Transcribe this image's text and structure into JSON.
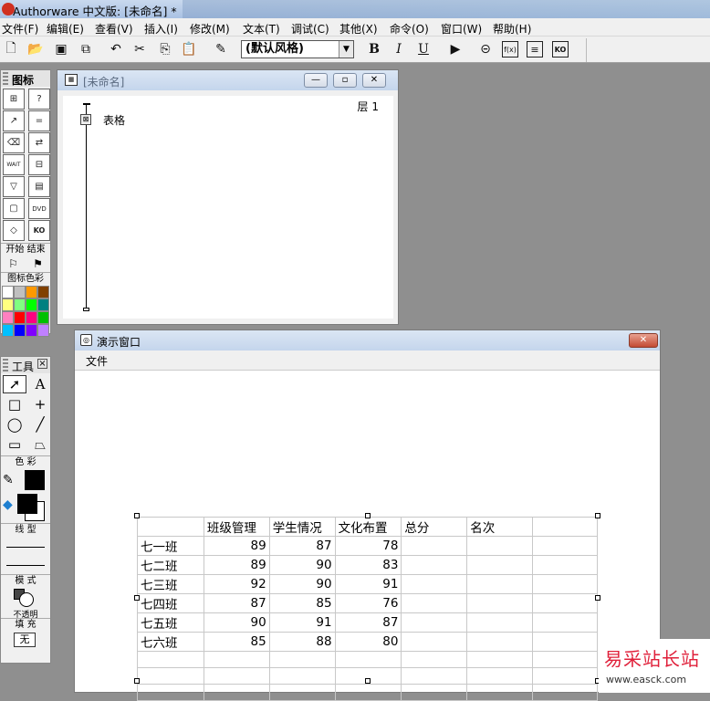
{
  "app": {
    "title": "Authorware 中文版: [未命名] *"
  },
  "menu": [
    "文件(F)",
    "编辑(E)",
    "查看(V)",
    "插入(I)",
    "修改(M)",
    "文本(T)",
    "调试(C)",
    "其他(X)",
    "命令(O)",
    "窗口(W)",
    "帮助(H)"
  ],
  "toolbar": {
    "style_select": "(默认风格)",
    "bold": "B",
    "italic": "I",
    "underline": "U"
  },
  "icon_palette": {
    "title": "图标",
    "start_label": "开始",
    "end_label": "结束",
    "icon_color_label": "图标色彩",
    "colors": [
      "#ffffff",
      "#c0c0c0",
      "#ff9900",
      "#804000",
      "#ffff80",
      "#80ff80",
      "#00ff00",
      "#008080",
      "#ff80c0",
      "#ff0000",
      "#ff0080",
      "#00c000",
      "#00c0ff",
      "#0000ff",
      "#8000ff",
      "#c080ff"
    ]
  },
  "tools_palette": {
    "title": "工具",
    "color_label": "色 彩",
    "line_label": "线 型",
    "mode_label": "模 式",
    "mode_value": "不透明",
    "fill_label": "填 充",
    "fill_value": "无"
  },
  "flow_window": {
    "title": "[未命名]",
    "layer_label": "层 1",
    "icon_label": "表格"
  },
  "present_window": {
    "title": "演示窗口",
    "menu_file": "文件"
  },
  "table": {
    "headers": [
      "",
      "班级管理",
      "学生情况",
      "文化布置",
      "总分",
      "名次",
      ""
    ],
    "rows": [
      [
        "七一班",
        "89",
        "87",
        "78",
        "",
        "",
        ""
      ],
      [
        "七二班",
        "89",
        "90",
        "83",
        "",
        "",
        ""
      ],
      [
        "七三班",
        "92",
        "90",
        "91",
        "",
        "",
        ""
      ],
      [
        "七四班",
        "87",
        "85",
        "76",
        "",
        "",
        ""
      ],
      [
        "七五班",
        "90",
        "91",
        "87",
        "",
        "",
        ""
      ],
      [
        "七六班",
        "85",
        "88",
        "80",
        "",
        "",
        ""
      ],
      [
        "",
        "",
        "",
        "",
        "",
        "",
        ""
      ],
      [
        "",
        "",
        "",
        "",
        "",
        "",
        ""
      ],
      [
        "",
        "",
        "",
        "",
        "",
        "",
        ""
      ]
    ]
  },
  "watermark": {
    "text_cn": "易采站长站",
    "text_url": "www.easck.com"
  }
}
